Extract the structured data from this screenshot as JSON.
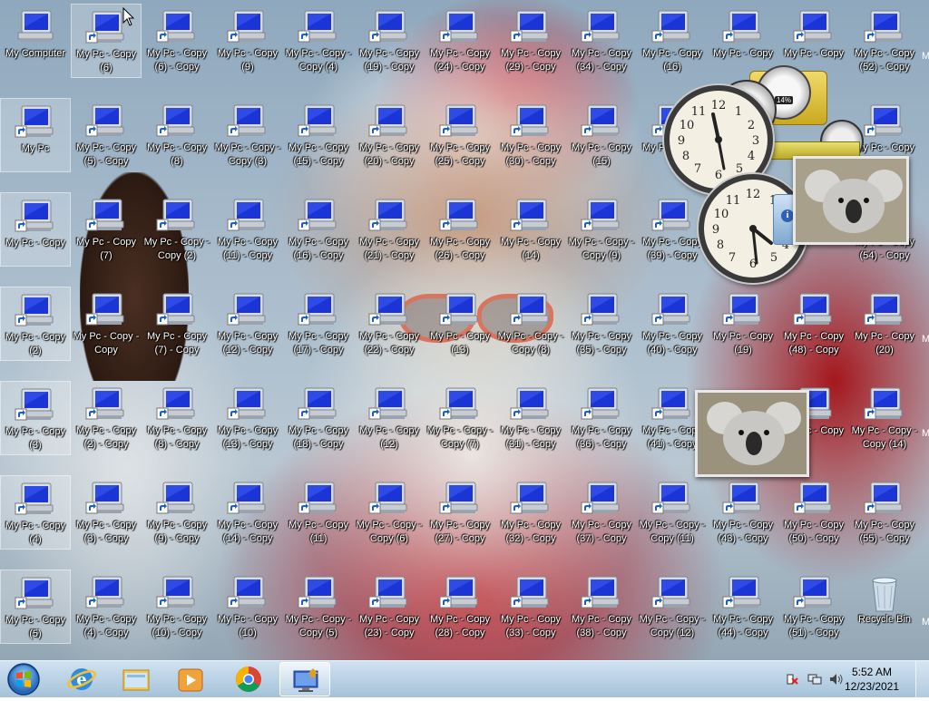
{
  "desktop": {
    "icons": [
      {
        "label": "My Computer",
        "col": 0,
        "row": 0,
        "shortcut": false,
        "selected": false
      },
      {
        "label": "My Pc - Copy (6)",
        "col": 1,
        "row": 0,
        "shortcut": true,
        "selected": true
      },
      {
        "label": "My Pc - Copy (6) - Copy",
        "col": 2,
        "row": 0,
        "shortcut": true
      },
      {
        "label": "My Pc - Copy (9)",
        "col": 3,
        "row": 0,
        "shortcut": true
      },
      {
        "label": "My Pc - Copy - Copy (4)",
        "col": 4,
        "row": 0,
        "shortcut": true
      },
      {
        "label": "My Pc - Copy (19) - Copy",
        "col": 5,
        "row": 0,
        "shortcut": true
      },
      {
        "label": "My Pc - Copy (24) - Copy",
        "col": 6,
        "row": 0,
        "shortcut": true
      },
      {
        "label": "My Pc - Copy (29) - Copy",
        "col": 7,
        "row": 0,
        "shortcut": true
      },
      {
        "label": "My Pc - Copy (34) - Copy",
        "col": 8,
        "row": 0,
        "shortcut": true
      },
      {
        "label": "My Pc - Copy (16)",
        "col": 9,
        "row": 0,
        "shortcut": true
      },
      {
        "label": "My Pc - Copy",
        "col": 10,
        "row": 0,
        "shortcut": true
      },
      {
        "label": "My Pc - Copy",
        "col": 11,
        "row": 0,
        "shortcut": true
      },
      {
        "label": "My Pc - Copy (52) - Copy",
        "col": 12,
        "row": 0,
        "shortcut": true
      },
      {
        "label": "My Pc",
        "col": 0,
        "row": 1,
        "shortcut": true,
        "selected": true
      },
      {
        "label": "My Pc - Copy (5) - Copy",
        "col": 1,
        "row": 1,
        "shortcut": true
      },
      {
        "label": "My Pc - Copy (8)",
        "col": 2,
        "row": 1,
        "shortcut": true
      },
      {
        "label": "My Pc - Copy - Copy (3)",
        "col": 3,
        "row": 1,
        "shortcut": true
      },
      {
        "label": "My Pc - Copy (15) - Copy",
        "col": 4,
        "row": 1,
        "shortcut": true
      },
      {
        "label": "My Pc - Copy (20) - Copy",
        "col": 5,
        "row": 1,
        "shortcut": true
      },
      {
        "label": "My Pc - Copy (25) - Copy",
        "col": 6,
        "row": 1,
        "shortcut": true
      },
      {
        "label": "My Pc - Copy (30) - Copy",
        "col": 7,
        "row": 1,
        "shortcut": true
      },
      {
        "label": "My Pc - Copy (15)",
        "col": 8,
        "row": 1,
        "shortcut": true
      },
      {
        "label": "My Pc - Copy",
        "col": 9,
        "row": 1,
        "shortcut": true
      },
      {
        "label": "My Pc - Copy",
        "col": 12,
        "row": 1,
        "shortcut": true
      },
      {
        "label": "My Pc - Copy",
        "col": 0,
        "row": 2,
        "shortcut": true,
        "selected": true
      },
      {
        "label": "My Pc - Copy (7)",
        "col": 1,
        "row": 2,
        "shortcut": true
      },
      {
        "label": "My Pc - Copy - Copy (2)",
        "col": 2,
        "row": 2,
        "shortcut": true
      },
      {
        "label": "My Pc - Copy (11) - Copy",
        "col": 3,
        "row": 2,
        "shortcut": true
      },
      {
        "label": "My Pc - Copy (16) - Copy",
        "col": 4,
        "row": 2,
        "shortcut": true
      },
      {
        "label": "My Pc - Copy (21) - Copy",
        "col": 5,
        "row": 2,
        "shortcut": true
      },
      {
        "label": "My Pc - Copy (26) - Copy",
        "col": 6,
        "row": 2,
        "shortcut": true
      },
      {
        "label": "My Pc - Copy (14)",
        "col": 7,
        "row": 2,
        "shortcut": true
      },
      {
        "label": "My Pc - Copy - Copy (9)",
        "col": 8,
        "row": 2,
        "shortcut": true
      },
      {
        "label": "My Pc - Copy (39) - Copy",
        "col": 9,
        "row": 2,
        "shortcut": true
      },
      {
        "label": "My Pc - Copy (54) - Copy",
        "col": 12,
        "row": 2,
        "shortcut": true
      },
      {
        "label": "My Pc - Copy (2)",
        "col": 0,
        "row": 3,
        "shortcut": true,
        "selected": true
      },
      {
        "label": "My Pc - Copy - Copy",
        "col": 1,
        "row": 3,
        "shortcut": true
      },
      {
        "label": "My Pc - Copy (7) - Copy",
        "col": 2,
        "row": 3,
        "shortcut": true
      },
      {
        "label": "My Pc - Copy (12) - Copy",
        "col": 3,
        "row": 3,
        "shortcut": true
      },
      {
        "label": "My Pc - Copy (17) - Copy",
        "col": 4,
        "row": 3,
        "shortcut": true
      },
      {
        "label": "My Pc - Copy (22) - Copy",
        "col": 5,
        "row": 3,
        "shortcut": true
      },
      {
        "label": "My Pc - Copy (13)",
        "col": 6,
        "row": 3,
        "shortcut": true
      },
      {
        "label": "My Pc - Copy - Copy (8)",
        "col": 7,
        "row": 3,
        "shortcut": true
      },
      {
        "label": "My Pc - Copy (35) - Copy",
        "col": 8,
        "row": 3,
        "shortcut": true
      },
      {
        "label": "My Pc - Copy (40) - Copy",
        "col": 9,
        "row": 3,
        "shortcut": true
      },
      {
        "label": "My Pc - Copy (19)",
        "col": 10,
        "row": 3,
        "shortcut": true
      },
      {
        "label": "My Pc - Copy (48) - Copy",
        "col": 11,
        "row": 3,
        "shortcut": true
      },
      {
        "label": "My Pc - Copy (20)",
        "col": 12,
        "row": 3,
        "shortcut": true
      },
      {
        "label": "My Pc - Copy (3)",
        "col": 0,
        "row": 4,
        "shortcut": true,
        "selected": true
      },
      {
        "label": "My Pc - Copy (2) - Copy",
        "col": 1,
        "row": 4,
        "shortcut": true
      },
      {
        "label": "My Pc - Copy (8) - Copy",
        "col": 2,
        "row": 4,
        "shortcut": true
      },
      {
        "label": "My Pc - Copy (13) - Copy",
        "col": 3,
        "row": 4,
        "shortcut": true
      },
      {
        "label": "My Pc - Copy (18) - Copy",
        "col": 4,
        "row": 4,
        "shortcut": true
      },
      {
        "label": "My Pc - Copy (12)",
        "col": 5,
        "row": 4,
        "shortcut": true
      },
      {
        "label": "My Pc - Copy - Copy (7)",
        "col": 6,
        "row": 4,
        "shortcut": true
      },
      {
        "label": "My Pc - Copy (31) - Copy",
        "col": 7,
        "row": 4,
        "shortcut": true
      },
      {
        "label": "My Pc - Copy (36) - Copy",
        "col": 8,
        "row": 4,
        "shortcut": true
      },
      {
        "label": "My Pc - Copy (41) - Copy",
        "col": 9,
        "row": 4,
        "shortcut": true
      },
      {
        "label": "My Pc - Copy",
        "col": 11,
        "row": 4,
        "shortcut": true
      },
      {
        "label": "My Pc - Copy - Copy (14)",
        "col": 12,
        "row": 4,
        "shortcut": true
      },
      {
        "label": "My Pc - Copy (4)",
        "col": 0,
        "row": 5,
        "shortcut": true,
        "selected": true
      },
      {
        "label": "My Pc - Copy (3) - Copy",
        "col": 1,
        "row": 5,
        "shortcut": true
      },
      {
        "label": "My Pc - Copy (9) - Copy",
        "col": 2,
        "row": 5,
        "shortcut": true
      },
      {
        "label": "My Pc - Copy (14) - Copy",
        "col": 3,
        "row": 5,
        "shortcut": true
      },
      {
        "label": "My Pc - Copy (11)",
        "col": 4,
        "row": 5,
        "shortcut": true
      },
      {
        "label": "My Pc - Copy - Copy (6)",
        "col": 5,
        "row": 5,
        "shortcut": true
      },
      {
        "label": "My Pc - Copy (27) - Copy",
        "col": 6,
        "row": 5,
        "shortcut": true
      },
      {
        "label": "My Pc - Copy (32) - Copy",
        "col": 7,
        "row": 5,
        "shortcut": true
      },
      {
        "label": "My Pc - Copy (37) - Copy",
        "col": 8,
        "row": 5,
        "shortcut": true
      },
      {
        "label": "My Pc - Copy - Copy (11)",
        "col": 9,
        "row": 5,
        "shortcut": true
      },
      {
        "label": "My Pc - Copy (43) - Copy",
        "col": 10,
        "row": 5,
        "shortcut": true
      },
      {
        "label": "My Pc - Copy (50) - Copy",
        "col": 11,
        "row": 5,
        "shortcut": true
      },
      {
        "label": "My Pc - Copy (55) - Copy",
        "col": 12,
        "row": 5,
        "shortcut": true
      },
      {
        "label": "My Pc - Copy (5)",
        "col": 0,
        "row": 6,
        "shortcut": true,
        "selected": true
      },
      {
        "label": "My Pc - Copy (4) - Copy",
        "col": 1,
        "row": 6,
        "shortcut": true
      },
      {
        "label": "My Pc - Copy (10) - Copy",
        "col": 2,
        "row": 6,
        "shortcut": true
      },
      {
        "label": "My Pc - Copy (10)",
        "col": 3,
        "row": 6,
        "shortcut": true
      },
      {
        "label": "My Pc - Copy - Copy (5)",
        "col": 4,
        "row": 6,
        "shortcut": true
      },
      {
        "label": "My Pc - Copy (23) - Copy",
        "col": 5,
        "row": 6,
        "shortcut": true
      },
      {
        "label": "My Pc - Copy (28) - Copy",
        "col": 6,
        "row": 6,
        "shortcut": true
      },
      {
        "label": "My Pc - Copy (33) - Copy",
        "col": 7,
        "row": 6,
        "shortcut": true
      },
      {
        "label": "My Pc - Copy (38) - Copy",
        "col": 8,
        "row": 6,
        "shortcut": true
      },
      {
        "label": "My Pc - Copy - Copy (12)",
        "col": 9,
        "row": 6,
        "shortcut": true
      },
      {
        "label": "My Pc - Copy (44) - Copy",
        "col": 10,
        "row": 6,
        "shortcut": true
      },
      {
        "label": "My Pc - Copy (51) - Copy",
        "col": 11,
        "row": 6,
        "shortcut": true
      },
      {
        "label": "Recycle Bin",
        "col": 12,
        "row": 6,
        "shortcut": false,
        "recycle": true
      }
    ],
    "right_edge_labels": [
      "M",
      "M",
      "M",
      "M"
    ]
  },
  "gadgets": {
    "cpu_meter_value": "14%",
    "clock_main_time": "12:28",
    "clock_second_time": "5:52"
  },
  "taskbar": {
    "start_icon": "windows-orb-icon",
    "pinned": [
      {
        "name": "internet-explorer-icon",
        "label": "Internet Explorer"
      },
      {
        "name": "file-explorer-icon",
        "label": "Windows Explorer"
      },
      {
        "name": "media-player-icon",
        "label": "Windows Media Player"
      },
      {
        "name": "chrome-icon",
        "label": "Google Chrome"
      },
      {
        "name": "remote-desktop-icon",
        "label": "Remote Desktop"
      }
    ],
    "tray": {
      "time": "5:52 AM",
      "date": "12/23/2021"
    }
  },
  "colors": {
    "taskbar_top": "#cde1f0",
    "taskbar_bottom": "#a0bed7",
    "icon_screen": "#1a34d6",
    "label_text": "#ffffff"
  }
}
